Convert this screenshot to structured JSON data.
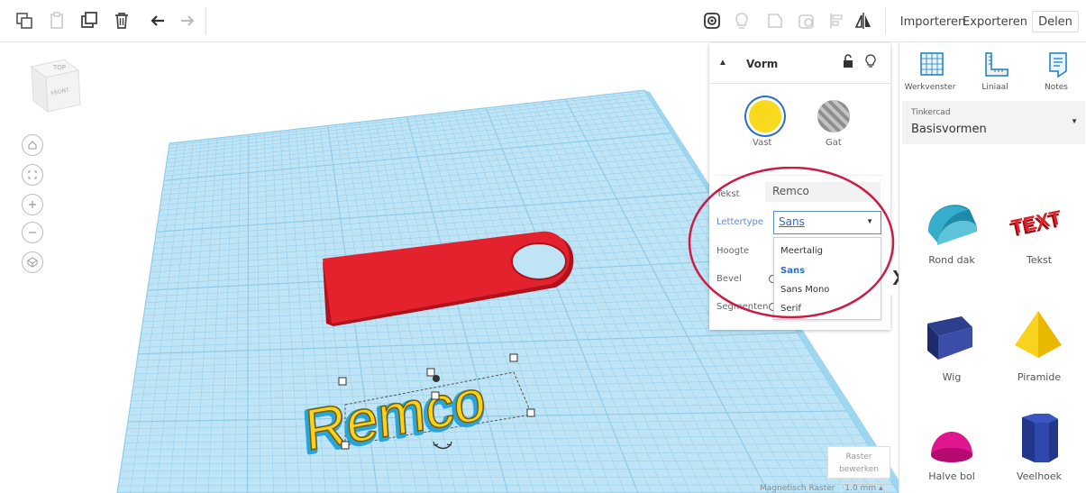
{
  "toolbar": {
    "importeren": "Importeren",
    "exporteren": "Exporteren",
    "delen": "Delen"
  },
  "viewcube": {
    "top": "TOP",
    "front": "FRONT"
  },
  "inspector": {
    "title": "Vorm",
    "solid_label": "Vast",
    "hole_label": "Gat",
    "text_label": "Tekst",
    "text_value": "Remco",
    "font_label": "Lettertype",
    "font_value": "Sans",
    "height_label": "Hoogte",
    "bevel_label": "Bevel",
    "segments_label": "Segmenten",
    "font_options": [
      "Meertalig",
      "Sans",
      "Sans Mono",
      "Serif"
    ],
    "selected_font_index": 1
  },
  "canvas": {
    "scene_text": "Remco",
    "raster_btn": "Raster bewerken",
    "raster_line1": "Raster",
    "raster_line2": "bewerken",
    "snap_label": "Magnetisch Raster",
    "snap_value": "1.0 mm"
  },
  "right_panel": {
    "workplane": "Werkvenster",
    "ruler": "Liniaal",
    "notes": "Notes",
    "lib_source": "Tinkercad",
    "lib_name": "Basisvormen",
    "shapes": [
      "Rond dak",
      "Tekst",
      "Wig",
      "Piramide",
      "Halve bol",
      "Veelhoek"
    ]
  },
  "colors": {
    "accent": "#2c6ecb",
    "solid_yellow": "#f9d91c",
    "keychain_red": "#e3222e",
    "grid_blue": "#b4def4",
    "highlight_ring": "#cc1b45"
  }
}
